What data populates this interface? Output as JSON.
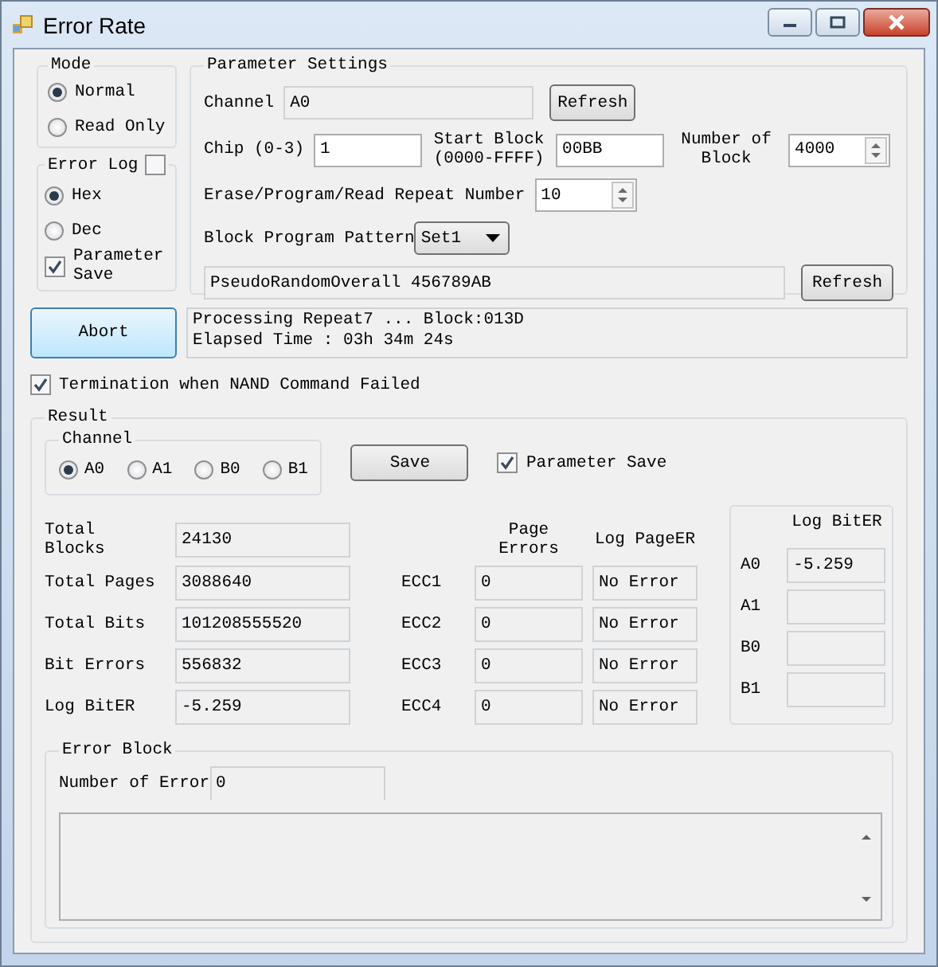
{
  "window": {
    "title": "Error Rate"
  },
  "mode_settings": {
    "title": "Mode",
    "options": [
      {
        "label": "Normal",
        "selected": true
      },
      {
        "label": "Read Only",
        "selected": false
      }
    ]
  },
  "error_log": {
    "title": "Error Log",
    "checked": false,
    "formats": [
      {
        "label": "Hex",
        "selected": true
      },
      {
        "label": "Dec",
        "selected": false
      }
    ],
    "parameter_save": {
      "label": "Parameter Save",
      "checked": true
    }
  },
  "parameter_settings": {
    "title": "Parameter Settings",
    "channel": {
      "label": "Channel",
      "value": "A0",
      "button": "Refresh"
    },
    "chip": {
      "label": "Chip (0-3)",
      "value": "1"
    },
    "start_block": {
      "label": "Start Block (0000-FFFF)",
      "value": "00BB"
    },
    "number_of_block": {
      "label": "Number of Block",
      "value": "4000"
    },
    "repeat_number": {
      "label": "Erase/Program/Read Repeat Number",
      "value": "10"
    },
    "block_program_pattern": {
      "label": "Block Program Pattern",
      "value": "Set1"
    },
    "pattern": {
      "value": "PseudoRandomOverall 456789AB",
      "button": "Refresh"
    }
  },
  "abort_button": "Abort",
  "status_lines": [
    "Processing Repeat7 ... Block:013D",
    "Elapsed Time : 03h 34m 24s"
  ],
  "termination": {
    "label": "Termination when NAND Command Failed",
    "checked": true
  },
  "result": {
    "title": "Result",
    "channel": {
      "title": "Channel",
      "options": [
        {
          "label": "A0",
          "selected": true
        },
        {
          "label": "A1",
          "selected": false
        },
        {
          "label": "B0",
          "selected": false
        },
        {
          "label": "B1",
          "selected": false
        }
      ]
    },
    "save_button": "Save",
    "parameter_save": {
      "label": "Parameter Save",
      "checked": true
    },
    "page_errors_header": "Page Errors",
    "log_pager_header": "Log PageER",
    "rows": [
      {
        "label": "Total Blocks",
        "value": "24130"
      },
      {
        "label": "Total Pages",
        "value": "3088640",
        "ecc": "ECC1",
        "page_errors": "0",
        "log_pager": "No Error"
      },
      {
        "label": "Total Bits",
        "value": "101208555520",
        "ecc": "ECC2",
        "page_errors": "0",
        "log_pager": "No Error"
      },
      {
        "label": "Bit Errors",
        "value": "556832",
        "ecc": "ECC3",
        "page_errors": "0",
        "log_pager": "No Error"
      },
      {
        "label": "Log BitER",
        "value": "-5.259",
        "ecc": "ECC4",
        "page_errors": "0",
        "log_pager": "No Error"
      }
    ],
    "log_biter": {
      "title": "Log BitER",
      "rows": [
        {
          "label": "A0",
          "value": "-5.259"
        },
        {
          "label": "A1"
        },
        {
          "label": "B0"
        },
        {
          "label": "B1"
        }
      ]
    },
    "error_block": {
      "title": "Error Block",
      "number_label": "Number of Error",
      "number_value": "0"
    }
  }
}
